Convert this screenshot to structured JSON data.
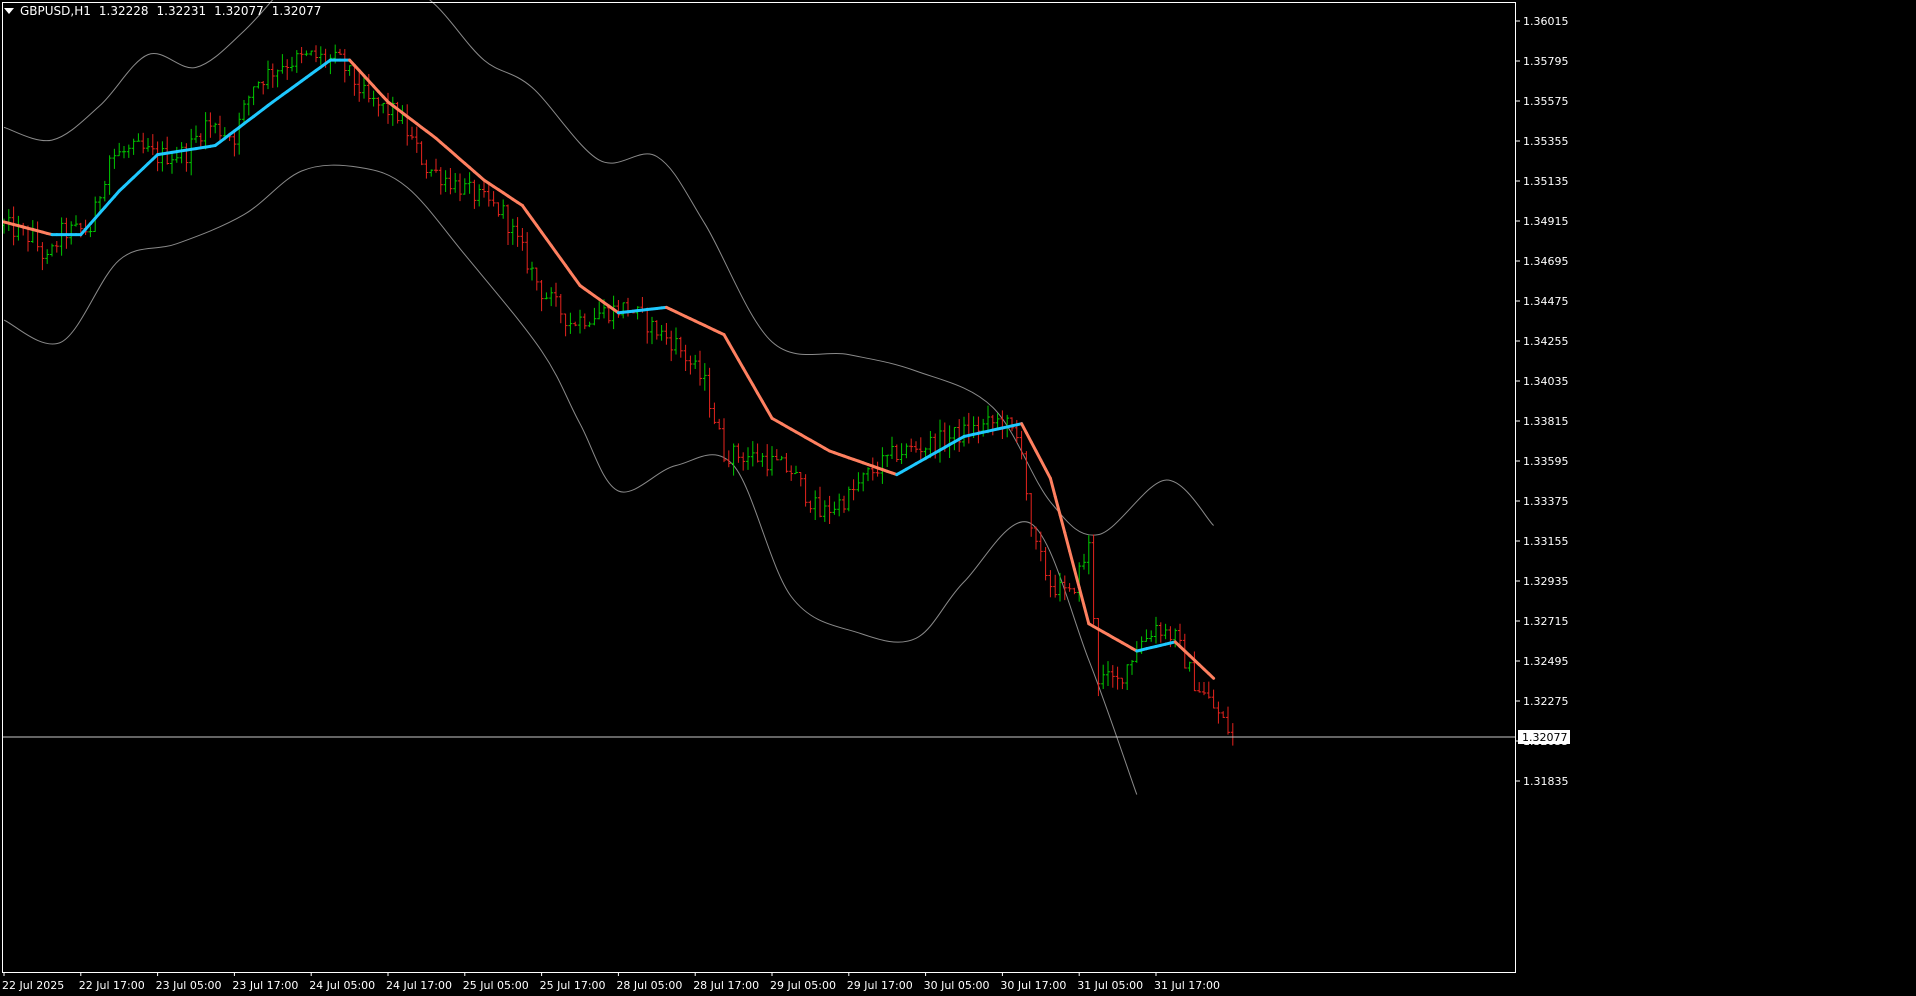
{
  "header": {
    "symbol": "GBPUSD,H1",
    "open": "1.32228",
    "high": "1.32231",
    "low": "1.32077",
    "close": "1.32077"
  },
  "colors": {
    "background": "#000000",
    "axis": "#ffffff",
    "bull_bar": "#00c800",
    "bear_bar": "#e6231e",
    "band": "#8a8a8a",
    "ma_up": "#1ec8ff",
    "ma_down": "#ff8060",
    "price_line": "#c8c8c8"
  },
  "chart_data": {
    "type": "ohlc",
    "symbol": "GBPUSD",
    "timeframe": "H1",
    "y_ticks": [
      "1.36015",
      "1.35795",
      "1.35575",
      "1.35355",
      "1.35135",
      "1.34915",
      "1.34695",
      "1.34475",
      "1.34255",
      "1.34035",
      "1.33815",
      "1.33595",
      "1.33375",
      "1.33155",
      "1.32935",
      "1.32715",
      "1.32495",
      "1.32275",
      "1.32055",
      "1.31835"
    ],
    "ylim": [
      1.3176,
      1.3608
    ],
    "x_labels": [
      "22 Jul 2025",
      "22 Jul 17:00",
      "23 Jul 05:00",
      "23 Jul 17:00",
      "24 Jul 05:00",
      "24 Jul 17:00",
      "25 Jul 05:00",
      "25 Jul 17:00",
      "28 Jul 05:00",
      "28 Jul 17:00",
      "29 Jul 05:00",
      "29 Jul 17:00",
      "30 Jul 05:00",
      "30 Jul 17:00",
      "31 Jul 05:00",
      "31 Jul 17:00"
    ],
    "x_label_bar_index": [
      0,
      16,
      32,
      48,
      64,
      80,
      96,
      112,
      128,
      144,
      160,
      176,
      192,
      208,
      224,
      240
    ],
    "current_price": "1.32077",
    "current_price_value": 1.32077,
    "ma_series": [
      [
        0,
        1.3491
      ],
      [
        10,
        1.3484
      ],
      [
        16,
        1.3484
      ],
      [
        24,
        1.3508
      ],
      [
        32,
        1.3528
      ],
      [
        44,
        1.3533
      ],
      [
        56,
        1.3557
      ],
      [
        68,
        1.358
      ],
      [
        72,
        1.358
      ],
      [
        80,
        1.3557
      ],
      [
        90,
        1.3537
      ],
      [
        100,
        1.3514
      ],
      [
        108,
        1.35
      ],
      [
        120,
        1.3456
      ],
      [
        128,
        1.3441
      ],
      [
        138,
        1.3444
      ],
      [
        150,
        1.3429
      ],
      [
        160,
        1.3383
      ],
      [
        172,
        1.3365
      ],
      [
        186,
        1.3352
      ],
      [
        200,
        1.3373
      ],
      [
        212,
        1.338
      ],
      [
        218,
        1.335
      ],
      [
        226,
        1.327
      ],
      [
        236,
        1.3255
      ],
      [
        244,
        1.326
      ],
      [
        252,
        1.324
      ]
    ],
    "upper_band": [
      [
        0,
        1.3543
      ],
      [
        10,
        1.3536
      ],
      [
        20,
        1.3555
      ],
      [
        30,
        1.3583
      ],
      [
        40,
        1.3576
      ],
      [
        50,
        1.3596
      ],
      [
        60,
        1.3625
      ],
      [
        70,
        1.365
      ],
      [
        80,
        1.363
      ],
      [
        90,
        1.361
      ],
      [
        100,
        1.358
      ],
      [
        110,
        1.3565
      ],
      [
        124,
        1.3525
      ],
      [
        136,
        1.3527
      ],
      [
        146,
        1.349
      ],
      [
        160,
        1.3425
      ],
      [
        176,
        1.3418
      ],
      [
        190,
        1.3409
      ],
      [
        206,
        1.3389
      ],
      [
        218,
        1.3337
      ],
      [
        228,
        1.3319
      ],
      [
        242,
        1.3349
      ],
      [
        252,
        1.3324
      ]
    ],
    "lower_band": [
      [
        0,
        1.3437
      ],
      [
        12,
        1.3425
      ],
      [
        24,
        1.347
      ],
      [
        36,
        1.3479
      ],
      [
        50,
        1.3495
      ],
      [
        62,
        1.3519
      ],
      [
        74,
        1.3521
      ],
      [
        84,
        1.351
      ],
      [
        96,
        1.3473
      ],
      [
        112,
        1.342
      ],
      [
        120,
        1.338
      ],
      [
        128,
        1.3343
      ],
      [
        140,
        1.3357
      ],
      [
        152,
        1.3357
      ],
      [
        164,
        1.3285
      ],
      [
        178,
        1.3265
      ],
      [
        190,
        1.3262
      ],
      [
        200,
        1.3293
      ],
      [
        214,
        1.3325
      ],
      [
        226,
        1.325
      ],
      [
        236,
        1.3176
      ]
    ],
    "price_path": [
      [
        0,
        1.3489
      ],
      [
        6,
        1.3482
      ],
      [
        9,
        1.3469
      ],
      [
        12,
        1.3485
      ],
      [
        18,
        1.3487
      ],
      [
        22,
        1.3527
      ],
      [
        28,
        1.3531
      ],
      [
        32,
        1.3527
      ],
      [
        38,
        1.3529
      ],
      [
        42,
        1.3545
      ],
      [
        48,
        1.3538
      ],
      [
        52,
        1.3567
      ],
      [
        58,
        1.3578
      ],
      [
        64,
        1.3582
      ],
      [
        70,
        1.3579
      ],
      [
        76,
        1.3557
      ],
      [
        82,
        1.355
      ],
      [
        88,
        1.3521
      ],
      [
        96,
        1.3509
      ],
      [
        104,
        1.3496
      ],
      [
        112,
        1.3453
      ],
      [
        118,
        1.3436
      ],
      [
        124,
        1.3441
      ],
      [
        130,
        1.3444
      ],
      [
        136,
        1.3431
      ],
      [
        140,
        1.3424
      ],
      [
        146,
        1.3402
      ],
      [
        150,
        1.3364
      ],
      [
        158,
        1.3361
      ],
      [
        164,
        1.3354
      ],
      [
        170,
        1.333
      ],
      [
        176,
        1.334
      ],
      [
        180,
        1.3352
      ],
      [
        186,
        1.3364
      ],
      [
        192,
        1.3368
      ],
      [
        200,
        1.3375
      ],
      [
        208,
        1.3382
      ],
      [
        212,
        1.3368
      ],
      [
        214,
        1.3318
      ],
      [
        218,
        1.3292
      ],
      [
        222,
        1.3285
      ],
      [
        226,
        1.3312
      ],
      [
        228,
        1.324
      ],
      [
        232,
        1.3238
      ],
      [
        236,
        1.3257
      ],
      [
        240,
        1.3269
      ],
      [
        244,
        1.3262
      ],
      [
        248,
        1.3238
      ],
      [
        252,
        1.3224
      ],
      [
        256,
        1.3208
      ]
    ]
  }
}
